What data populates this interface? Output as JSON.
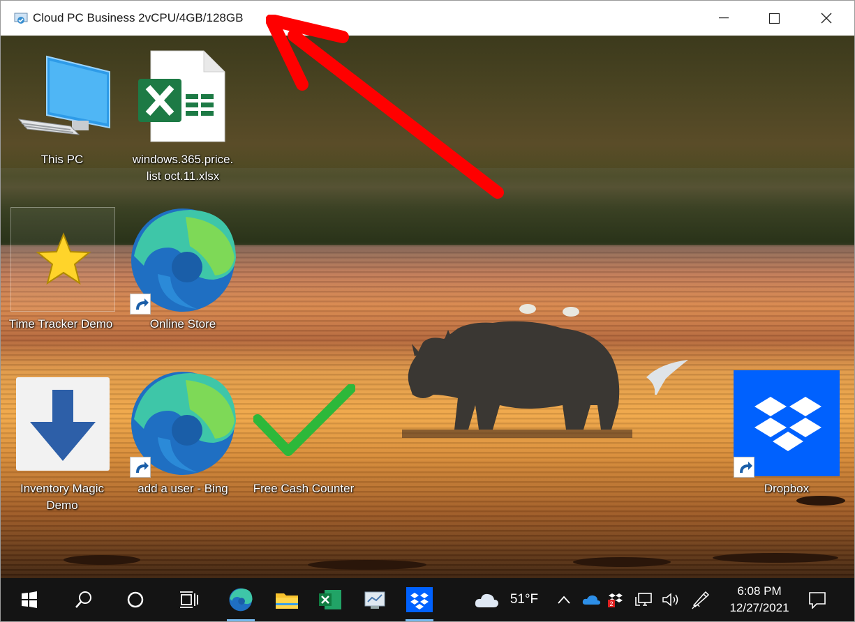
{
  "window": {
    "title": "Cloud PC Business 2vCPU/4GB/128GB",
    "controls": [
      "minimize",
      "maximize",
      "close"
    ]
  },
  "desktop_icons": [
    {
      "label": "This PC",
      "icon": "monitor-icon"
    },
    {
      "label": "windows.365.price.\nlist oct.11.xlsx",
      "icon": "excel-file-icon"
    },
    {
      "label": "Time Tracker Demo",
      "icon": "star-icon"
    },
    {
      "label": "Online Store",
      "icon": "edge-icon",
      "shortcut": true
    },
    {
      "label": "Inventory Magic\nDemo",
      "icon": "download-arrow-icon"
    },
    {
      "label": "add a user - Bing",
      "icon": "edge-icon",
      "shortcut": true
    },
    {
      "label": "Free Cash Counter",
      "icon": "checkmark-icon"
    },
    {
      "label": "Dropbox",
      "icon": "dropbox-icon",
      "shortcut": true
    }
  ],
  "taskbar": {
    "pinned": [
      "start-icon",
      "search-icon",
      "cortana-icon",
      "task-view-icon",
      "edge-icon",
      "file-explorer-icon",
      "excel-icon",
      "screen-app-icon",
      "dropbox-icon"
    ],
    "active": [
      "edge-icon",
      "dropbox-icon"
    ],
    "weather": {
      "temp": "51°F",
      "icon": "cloud-icon"
    },
    "tray": [
      "chevron-up-icon",
      "onedrive-icon",
      "dropbox-tray-icon",
      "network-icon",
      "volume-icon",
      "pen-icon"
    ],
    "clock": {
      "time": "6:08 PM",
      "date": "12/27/2021"
    },
    "notifications": "action-center-icon"
  },
  "annotation": {
    "type": "red-arrow",
    "points_to": "window title"
  },
  "colors": {
    "accent": "#76b9ed",
    "arrow": "#ff0000",
    "taskbar": "#141414"
  }
}
